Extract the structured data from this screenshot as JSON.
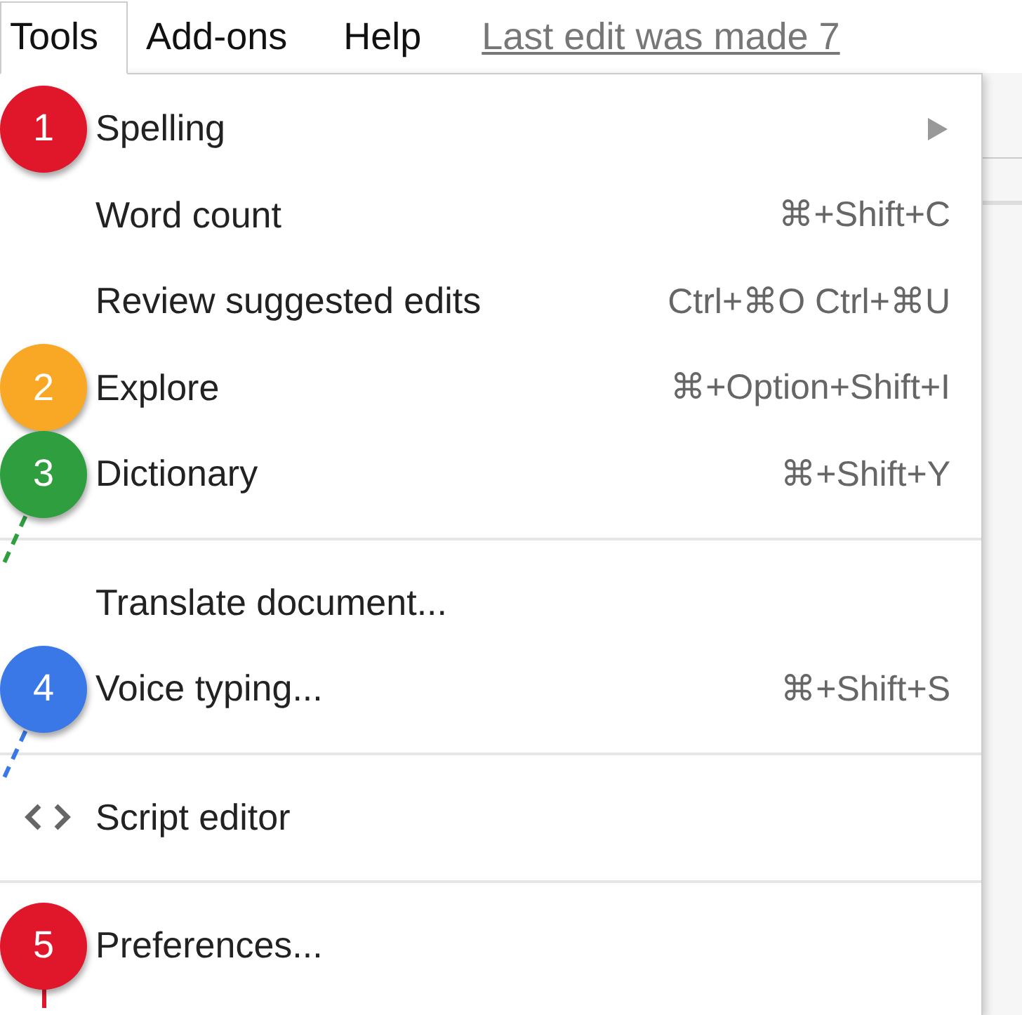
{
  "menu_bar": {
    "items": [
      {
        "label": "Tools",
        "selected": true
      },
      {
        "label": "Add-ons",
        "selected": false
      },
      {
        "label": "Help",
        "selected": false
      }
    ],
    "last_edit": "Last edit was made 7"
  },
  "menu": {
    "items": [
      {
        "kind": "item",
        "label": "Spelling",
        "submenu": true,
        "callout": {
          "kind": "plain",
          "number": "1",
          "color": "#e0162b"
        }
      },
      {
        "kind": "item",
        "label": "Word count",
        "shortcut": "⌘+Shift+C"
      },
      {
        "kind": "item",
        "label": "Review suggested edits",
        "shortcut": "Ctrl+⌘O Ctrl+⌘U"
      },
      {
        "kind": "item",
        "label": "Explore",
        "shortcut": "⌘+Option+Shift+I",
        "callout": {
          "kind": "plain",
          "number": "2",
          "color": "#f9a825"
        }
      },
      {
        "kind": "item",
        "label": "Dictionary",
        "shortcut": "⌘+Shift+Y",
        "callout": {
          "kind": "dashed",
          "number": "3",
          "color": "#2e9e3e"
        }
      },
      {
        "kind": "separator"
      },
      {
        "kind": "item",
        "label": "Translate document..."
      },
      {
        "kind": "item",
        "label": "Voice typing...",
        "shortcut": "⌘+Shift+S",
        "callout": {
          "kind": "dashed",
          "number": "4",
          "color": "#3b78e7"
        }
      },
      {
        "kind": "separator"
      },
      {
        "kind": "code",
        "label": "Script editor"
      },
      {
        "kind": "separator"
      },
      {
        "kind": "item",
        "label": "Preferences...",
        "callout": {
          "kind": "solid",
          "number": "5",
          "color": "#e0162b"
        }
      }
    ]
  }
}
